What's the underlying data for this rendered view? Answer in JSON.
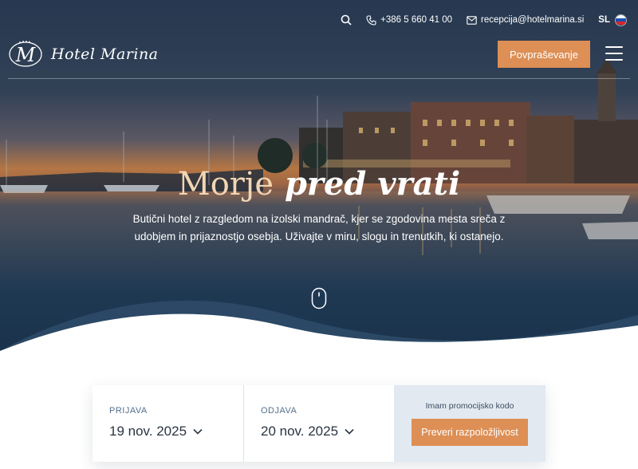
{
  "topbar": {
    "phone": "+386 5 660 41 00",
    "email": "recepcija@hotelmarina.si",
    "language": "SL"
  },
  "header": {
    "logo_monogram": "M",
    "logo_text": "Hotel Marina",
    "cta_label": "Povpraševanje"
  },
  "hero": {
    "title_part1": "Morje",
    "title_part2": "pred vrati",
    "subtitle": "Butični hotel z razgledom na izolski mandrač, kjer se zgodovina mesta sreča z udobjem in prijaznostjo osebja. Uživajte v miru, slogu in trenutkih, ki ostanejo."
  },
  "booking": {
    "checkin_label": "PRIJAVA",
    "checkin_value": "19 nov. 2025",
    "checkout_label": "ODJAVA",
    "checkout_value": "20 nov. 2025",
    "promo_label": "Imam promocijsko kodo",
    "check_button": "Preveri razpoložljivost"
  },
  "colors": {
    "accent": "#dd8f55",
    "sea_dark": "#1f3b57",
    "promo_bg": "#e2e9f0"
  },
  "icons": [
    "search-icon",
    "phone-icon",
    "mail-icon",
    "flag-si-icon",
    "menu-icon",
    "mouse-scroll-icon",
    "chevron-down-icon"
  ]
}
